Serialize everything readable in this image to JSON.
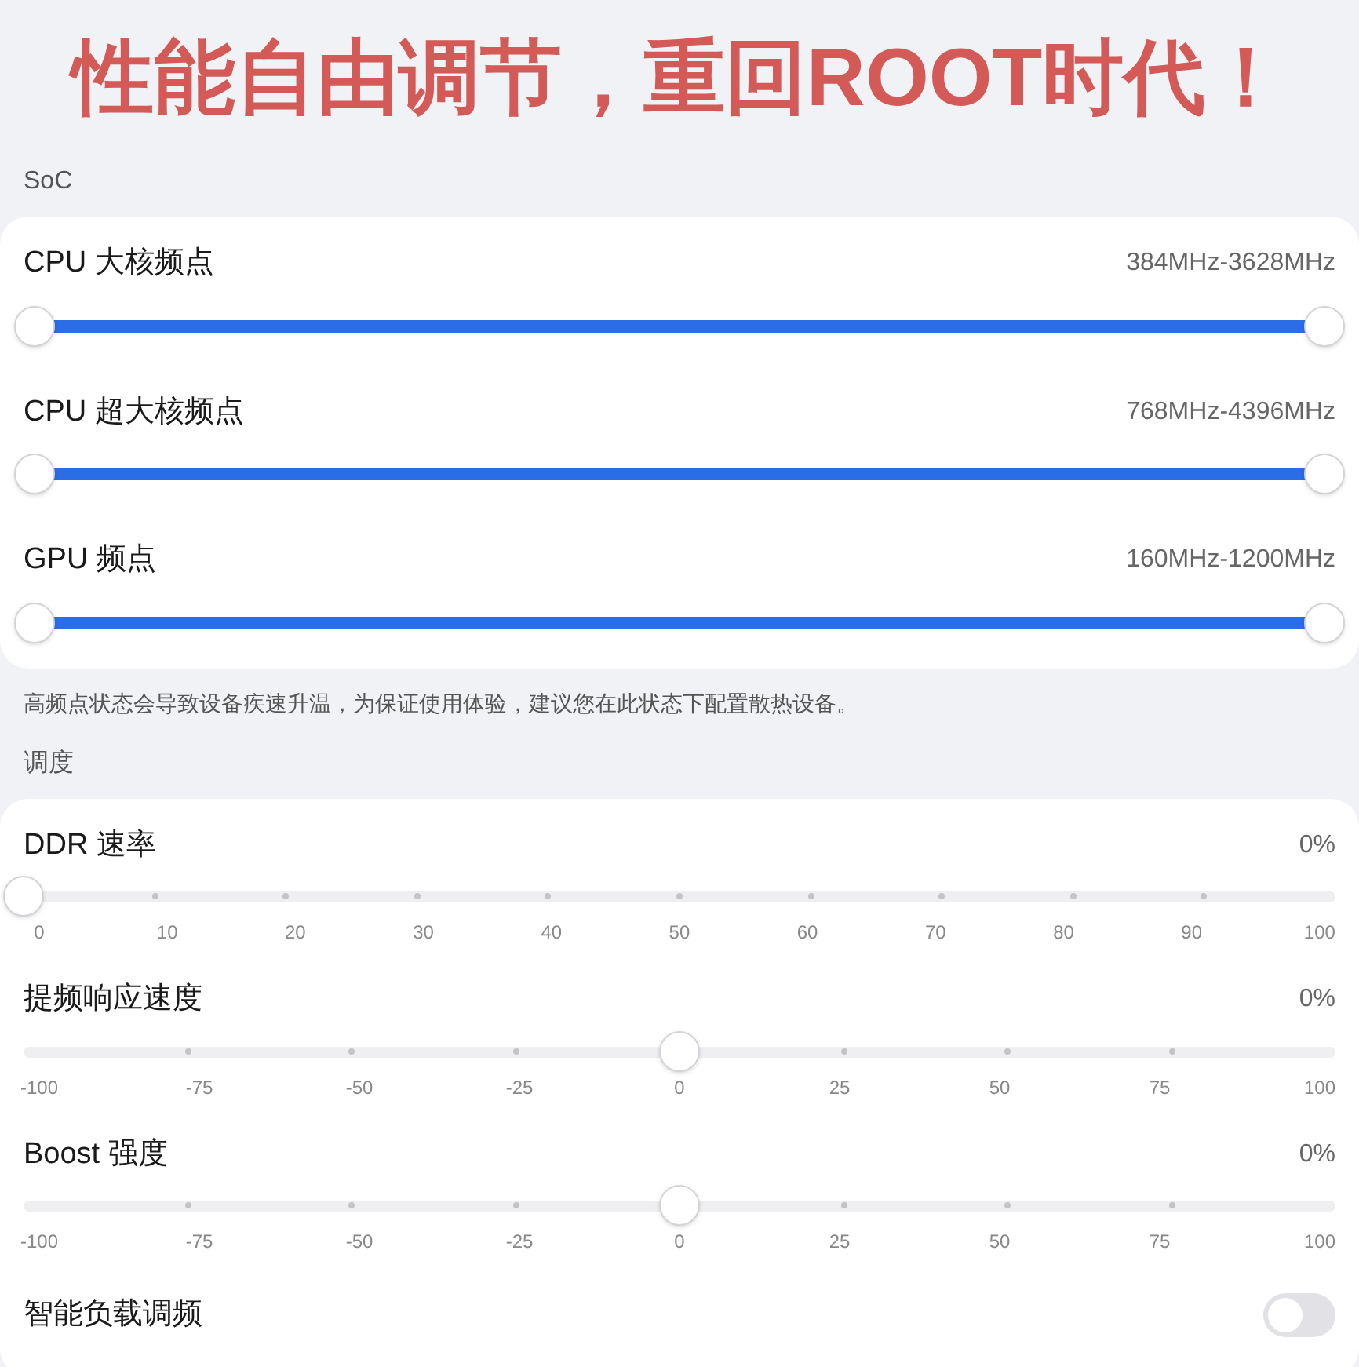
{
  "headline": "性能自由调节，重回ROOT时代！",
  "sections": [
    {
      "title": "SoC",
      "rows": [
        {
          "kind": "range",
          "label": "CPU 大核频点",
          "reading": "384MHz-3628MHz",
          "low": {
            "level": 0
          },
          "high": {
            "level": 1
          }
        },
        {
          "kind": "range",
          "label": "CPU 超大核频点",
          "reading": "768MHz-4396MHz",
          "low": {
            "level": 0
          },
          "high": {
            "level": 1
          }
        },
        {
          "kind": "range",
          "label": "GPU 频点",
          "reading": "160MHz-1200MHz",
          "low": {
            "level": 0
          },
          "high": {
            "level": 1
          }
        }
      ],
      "note": "高频点状态会导致设备疾速升温，为保证使用体验，建议您在此状态下配置散热设备。"
    },
    {
      "title": "调度",
      "rows": [
        {
          "kind": "ticked",
          "label": "DDR 速率",
          "reading": "0%",
          "level": 0,
          "ticks": [
            "0",
            "10",
            "20",
            "30",
            "40",
            "50",
            "60",
            "70",
            "80",
            "90",
            "100"
          ]
        },
        {
          "kind": "ticked",
          "label": "提频响应速度",
          "reading": "0%",
          "level": 0.5,
          "ticks": [
            "-100",
            "-75",
            "-50",
            "-25",
            "0",
            "25",
            "50",
            "75",
            "100"
          ]
        },
        {
          "kind": "ticked",
          "label": "Boost 强度",
          "reading": "0%",
          "level": 0.5,
          "ticks": [
            "-100",
            "-75",
            "-50",
            "-25",
            "0",
            "25",
            "50",
            "75",
            "100"
          ]
        },
        {
          "kind": "toggle",
          "label": "智能负载调频",
          "on": false
        }
      ]
    }
  ]
}
